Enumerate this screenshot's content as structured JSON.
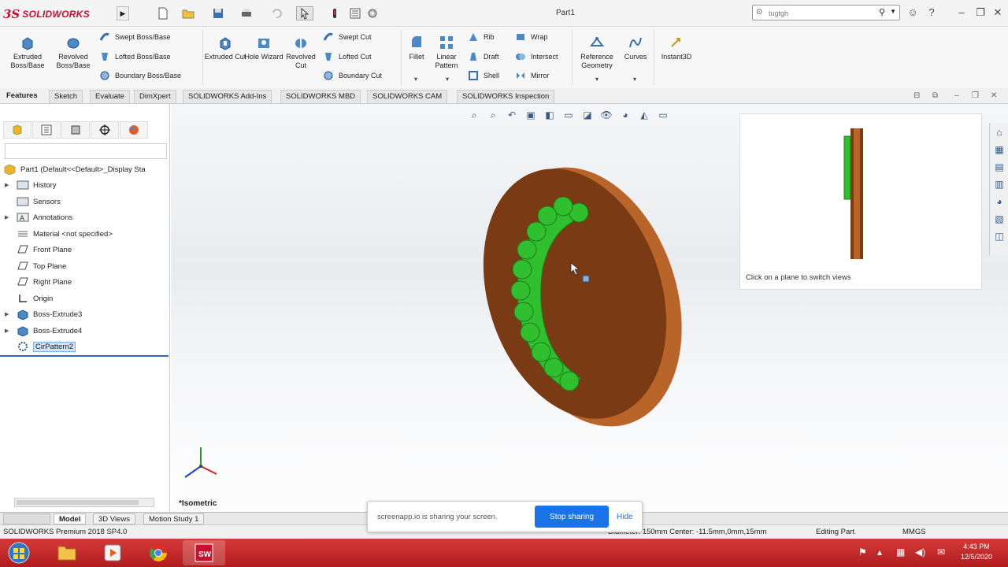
{
  "app": {
    "logo_ds": "3S",
    "logo_brand": "SOLIDWORKS",
    "doc_title": "Part1",
    "search_placeholder": "tugtgh"
  },
  "ribbon": {
    "extruded_boss": "Extruded Boss/Base",
    "revolved_boss": "Revolved Boss/Base",
    "swept_boss": "Swept Boss/Base",
    "lofted_boss": "Lofted Boss/Base",
    "boundary_boss": "Boundary Boss/Base",
    "extruded_cut": "Extruded Cut",
    "hole_wizard": "Hole Wizard",
    "revolved_cut": "Revolved Cut",
    "swept_cut": "Swept Cut",
    "lofted_cut": "Lofted Cut",
    "boundary_cut": "Boundary Cut",
    "fillet": "Fillet",
    "linear_pattern": "Linear Pattern",
    "rib": "Rib",
    "draft": "Draft",
    "shell": "Shell",
    "wrap": "Wrap",
    "intersect": "Intersect",
    "mirror": "Mirror",
    "reference_geometry": "Reference Geometry",
    "curves": "Curves",
    "instant3d": "Instant3D"
  },
  "tabs": [
    "Features",
    "Sketch",
    "Evaluate",
    "DimXpert",
    "SOLIDWORKS Add-Ins",
    "SOLIDWORKS MBD",
    "SOLIDWORKS CAM",
    "SOLIDWORKS Inspection"
  ],
  "tree": {
    "root": "Part1  (Default<<Default>_Display Sta",
    "items": [
      "History",
      "Sensors",
      "Annotations",
      "Material <not specified>",
      "Front Plane",
      "Top Plane",
      "Right Plane",
      "Origin",
      "Boss-Extrude3",
      "Boss-Extrude4",
      "CirPattern2"
    ]
  },
  "viewport": {
    "view_label": "*Isometric",
    "view_hint": "Click on a plane to switch views"
  },
  "bottom_tabs": [
    "Model",
    "3D Views",
    "Motion Study 1"
  ],
  "status": {
    "version": "SOLIDWORKS Premium 2018 SP4.0",
    "measure": "Diameter: 150mm  Center: -11.5mm,0mm,15mm",
    "mode": "Editing Part",
    "units": "MMGS"
  },
  "share": {
    "message": "screenapp.io is sharing your screen.",
    "stop": "Stop sharing",
    "hide": "Hide"
  },
  "clock": {
    "time": "4:43 PM",
    "date": "12/5/2020"
  },
  "colors": {
    "disc": "#7a3a14",
    "disc_rim": "#b9652a",
    "pattern": "#2fbf2f",
    "taskbar": "#c02424"
  }
}
